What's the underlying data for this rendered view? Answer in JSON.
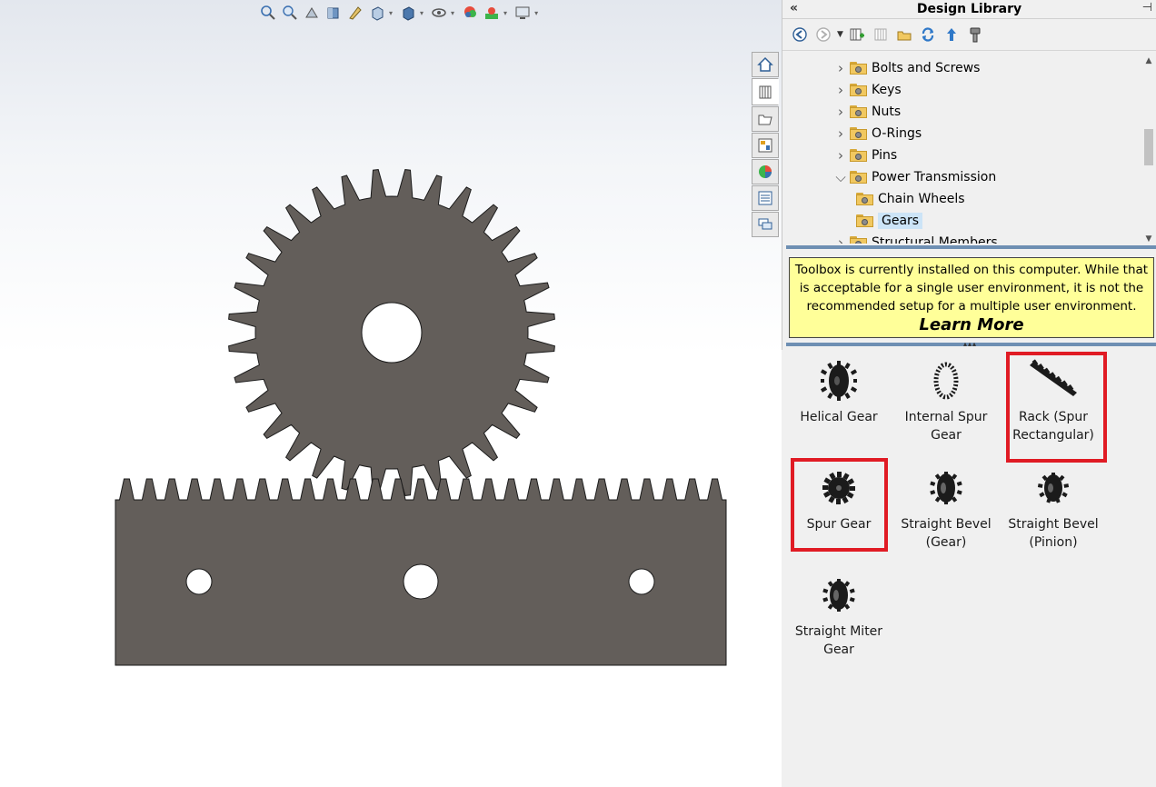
{
  "viewport": {
    "toolbar_icons": [
      "zoom-to-fit-icon",
      "zoom-to-area-icon",
      "previous-view-icon",
      "section-view-icon",
      "dynamic-annotation-icon",
      "view-orientation-icon",
      "display-style-icon",
      "hide-show-items-icon",
      "edit-appearance-icon",
      "apply-scene-icon",
      "view-settings-icon"
    ]
  },
  "taskpane_tabs": [
    {
      "name": "solidworks-resources-icon"
    },
    {
      "name": "design-library-icon"
    },
    {
      "name": "file-explorer-icon"
    },
    {
      "name": "view-palette-icon"
    },
    {
      "name": "appearances-scenes-icon"
    },
    {
      "name": "custom-properties-icon"
    },
    {
      "name": "forum-icon"
    }
  ],
  "panel": {
    "title": "Design Library",
    "toolbar_icons": [
      "back-icon",
      "forward-icon",
      "add-file-location-icon",
      "create-new-folder-icon",
      "refresh-icon",
      "up-folder-icon",
      "toolbox-icon"
    ]
  },
  "tree": {
    "items": [
      {
        "label": "Bolts and Screws",
        "level": 1,
        "expanded": false
      },
      {
        "label": "Keys",
        "level": 1,
        "expanded": false
      },
      {
        "label": "Nuts",
        "level": 1,
        "expanded": false
      },
      {
        "label": "O-Rings",
        "level": 1,
        "expanded": false
      },
      {
        "label": "Pins",
        "level": 1,
        "expanded": false
      },
      {
        "label": "Power Transmission",
        "level": 1,
        "expanded": true
      },
      {
        "label": "Chain Wheels",
        "level": 2
      },
      {
        "label": "Gears",
        "level": 2,
        "selected": true
      },
      {
        "label": "Structural Members",
        "level": 1,
        "expanded": false
      }
    ]
  },
  "notice": {
    "text": "Toolbox is currently installed on this computer. While that is acceptable for a single user environment, it is not the recommended setup for a multiple user environment.",
    "link": "Learn More",
    "background": "#ffff99"
  },
  "gears": {
    "items": [
      {
        "label": "Helical Gear",
        "highlighted": false
      },
      {
        "label": "Internal Spur Gear",
        "highlighted": false
      },
      {
        "label": "Rack (Spur Rectangular)",
        "highlighted": true
      },
      {
        "label": "Spur Gear",
        "highlighted": true
      },
      {
        "label": "Straight Bevel (Gear)",
        "highlighted": false
      },
      {
        "label": "Straight Bevel (Pinion)",
        "highlighted": false
      },
      {
        "label": "Straight Miter Gear",
        "highlighted": false
      }
    ],
    "highlight_color": "#e01b24"
  },
  "model": {
    "fill_color": "#635e5a",
    "gear_teeth": 32,
    "rack_teeth": 27,
    "rack_holes": 3
  }
}
